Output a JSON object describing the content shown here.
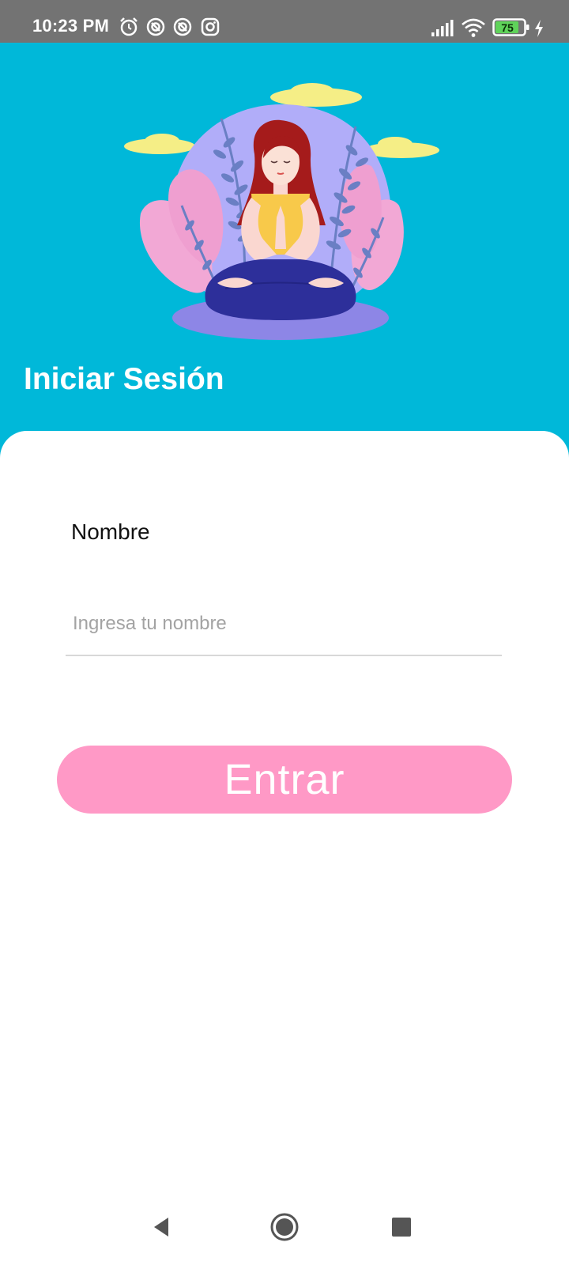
{
  "status_bar": {
    "time": "10:23 PM",
    "battery": "75",
    "icons_left": [
      "alarm-icon",
      "notification-icon",
      "notification-icon",
      "instagram-icon"
    ],
    "icons_right": [
      "signal-icon",
      "wifi-icon",
      "battery-icon",
      "charging-icon"
    ]
  },
  "header": {
    "title": "Iniciar Sesión",
    "background_color": "#00b8d9",
    "illustration": "meditating-woman-illustration"
  },
  "form": {
    "name_label": "Nombre",
    "name_placeholder": "Ingresa tu nombre",
    "name_value": ""
  },
  "actions": {
    "enter_label": "Entrar",
    "enter_color": "#ff99c6"
  },
  "navigation": {
    "back_icon": "back-icon",
    "home_icon": "home-icon",
    "recents_icon": "recents-icon"
  }
}
